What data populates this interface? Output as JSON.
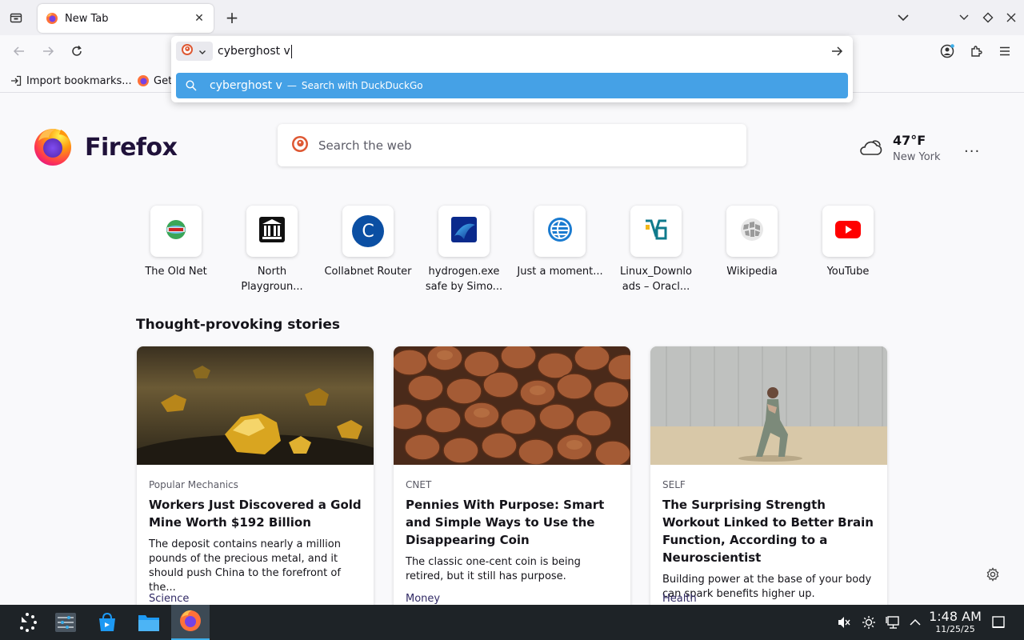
{
  "browser": {
    "tab": {
      "title": "New Tab"
    },
    "urlbar": {
      "typed": "cyberghost v",
      "suggestion_query": "cyberghost v",
      "suggestion_separator": "—",
      "suggestion_action": "Search with DuckDuckGo"
    },
    "bookmarks": [
      {
        "label": "Import bookmarks..."
      },
      {
        "label": "Get"
      }
    ]
  },
  "newtab": {
    "brand": "Firefox",
    "search_placeholder": "Search the web",
    "weather": {
      "temp": "47°F",
      "city": "New York"
    },
    "more_label": "···",
    "top_sites": [
      {
        "label": "The Old Net"
      },
      {
        "label": "North Playgroun..."
      },
      {
        "label": "Collabnet Router",
        "letter": "C"
      },
      {
        "label": "hydrogen.exe safe by Simo..."
      },
      {
        "label": "Just a moment..."
      },
      {
        "label": "Linux_Downlo ads – Oracl..."
      },
      {
        "label": "Wikipedia"
      },
      {
        "label": "YouTube"
      }
    ],
    "stories_heading": "Thought-provoking stories",
    "stories": [
      {
        "source": "Popular Mechanics",
        "title": "Workers Just Discovered a Gold Mine Worth $192 Billion",
        "desc": "The deposit contains nearly a million pounds of the precious metal, and it should push China to the forefront of the...",
        "topic": "Science"
      },
      {
        "source": "CNET",
        "title": "Pennies With Purpose: Smart and Simple Ways to Use the Disappearing Coin",
        "desc": "The classic one-cent coin is being retired, but it still has purpose.",
        "topic": "Money"
      },
      {
        "source": "SELF",
        "title": "The Surprising Strength Workout Linked to Better Brain Function, According to a Neuroscientist",
        "desc": "Building power at the base of your body can spark benefits higher up.",
        "topic": "Health"
      }
    ]
  },
  "taskbar": {
    "time": "1:48 AM",
    "date": "11/25/25"
  },
  "colors": {
    "suggestion_bg": "#45a1e6",
    "taskbar_bg": "#1e2327",
    "youtube_red": "#ff0000",
    "collabnet_blue": "#0b4fa3"
  }
}
